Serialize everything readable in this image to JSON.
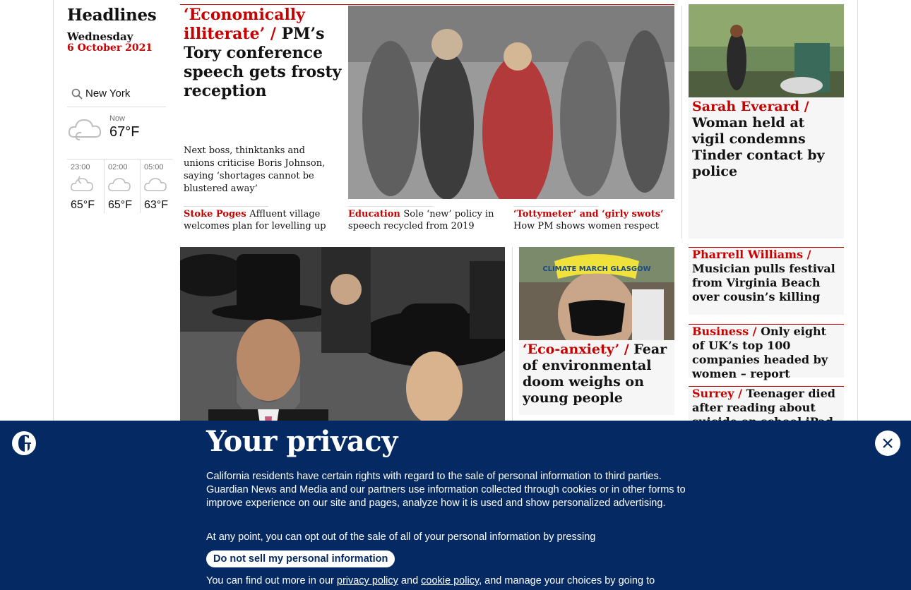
{
  "sidebar": {
    "section_title": "Headlines",
    "date_day": "Wednesday",
    "date_full": "6 October 2021",
    "location_value": "New York",
    "now_label": "Now",
    "now_temp": "67°F",
    "forecast": [
      {
        "time": "23:00",
        "temp": "65°F",
        "icon": "cloudy-night-icon"
      },
      {
        "time": "02:00",
        "temp": "65°F",
        "icon": "cloud-icon"
      },
      {
        "time": "05:00",
        "temp": "63°F",
        "icon": "cloud-icon"
      }
    ]
  },
  "lead": {
    "kicker": "‘Economically illiterate’ /",
    "headline": "PM’s Tory conference speech gets frosty reception",
    "standfirst": "Next boss, thinktanks and unions criticise Boris Johnson, saying ‘shortages cannot be blustered away’",
    "subs": [
      {
        "kicker": "Stoke Poges",
        "text": "Affluent village welcomes plan for levelling up"
      },
      {
        "kicker": "Education",
        "text": "Sole ‘new’ policy in speech recycled from 2019"
      },
      {
        "kicker": "‘Tottymeter’ and ‘girly swots’",
        "text": "How PM shows women respect"
      }
    ]
  },
  "right": [
    {
      "kicker": "Sarah Everard /",
      "text": "Woman held at vigil condemns Tinder contact by police"
    },
    {
      "kicker": "Pharrell Williams /",
      "text": "Musician pulls festival from Virginia Beach over cousin’s killing"
    },
    {
      "kicker": "Business /",
      "text": "Only eight of UK’s top 100 companies headed by women – report"
    },
    {
      "kicker": "Surrey /",
      "text": "Teenager died after reading about suicide on school iPad"
    }
  ],
  "eco": {
    "kicker": "‘Eco-anxiety’ /",
    "text": "Fear of environmental doom weighs on young people",
    "photo_sign": "CLIMATE MARCH GLASGOW"
  },
  "privacy": {
    "title": "Your privacy",
    "p1": "California residents have certain rights with regard to the sale of personal information to third parties. Guardian News and Media and our partners use information collected through cookies or in other forms to improve experience on our site and pages, analyze how it is used and show personalized advertising.",
    "p2": "At any point, you can opt out of the sale of all of your personal information by pressing",
    "button": "Do not sell my personal information",
    "p3_before": "You can find out more in our ",
    "privacy_link": "privacy policy",
    "p3_and": " and ",
    "cookie_link": "cookie policy",
    "p3_after": ", and manage your choices by going to"
  },
  "colors": {
    "accent": "#c70000",
    "banner": "#052962",
    "card_bg": "#f6f6f6"
  }
}
